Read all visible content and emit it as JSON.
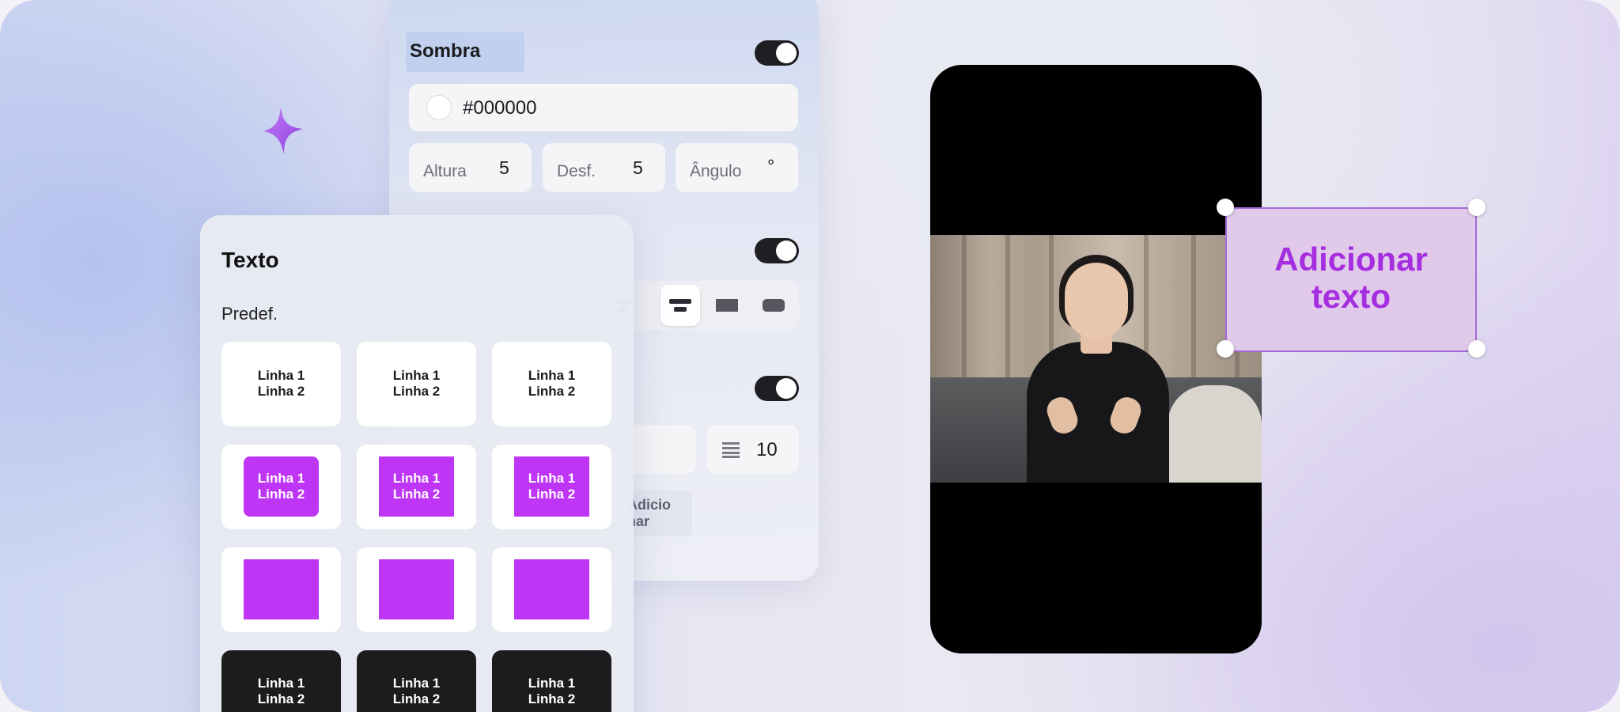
{
  "shadow_panel": {
    "title": "Sombra",
    "color_value": "#000000",
    "height_label": "Altura",
    "height_value": "5",
    "blur_label": "Desf.",
    "blur_value": "5",
    "angle_label": "Ângulo",
    "angle_value": "°",
    "spacing_value": "10",
    "add_button_label": "Adicio nar"
  },
  "text_panel": {
    "title": "Texto",
    "presets_label": "Predef.",
    "preset_line1": "Linha 1",
    "preset_line2": "Linha 2"
  },
  "canvas": {
    "overlay_text_line1": "Adicionar",
    "overlay_text_line2": "texto"
  },
  "colors": {
    "accent": "#bf35f5",
    "overlay_text": "#a52fe0",
    "overlay_bg": "#e1c9ea",
    "toggle": "#1f1f23"
  }
}
